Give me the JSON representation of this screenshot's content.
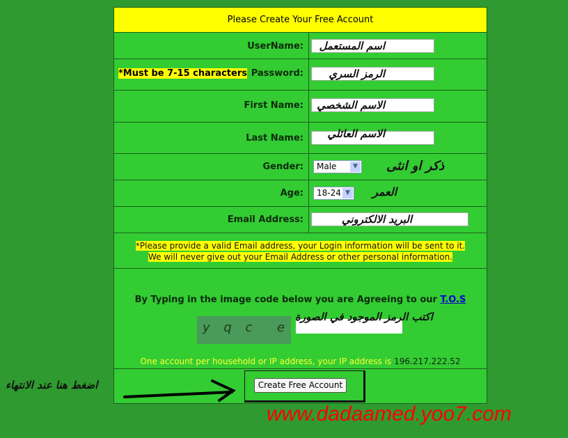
{
  "form": {
    "title": "Please Create Your Free Account",
    "username_label": "UserName:",
    "username_value": "اسم المستعمل",
    "password_hint": "*Must be 7-15 characters",
    "password_label": "Password:",
    "password_value": "الرمز السري",
    "firstname_label": "First Name:",
    "firstname_value": "الاسم الشخصي",
    "lastname_label": "Last Name:",
    "lastname_value": "الاسم العائلي",
    "gender_label": "Gender:",
    "gender_value": "Male",
    "gender_note": "ذكر او انثى",
    "age_label": "Age:",
    "age_value": "18-24",
    "age_note": "العمر",
    "email_label": "Email Address:",
    "email_value": "البريد الالكتروني",
    "email_notice_1": "*Please provide a valid Email address, your Login information will be sent to it.",
    "email_notice_2": "We will never give out your Email Address or other personal information.",
    "tos_text": "By Typing in the image code below you are Agreeing to our",
    "tos_link": "T.O.S",
    "captcha_image_text": "y q c  e n",
    "captcha_note": "اكتب الرمز الموجود في الصورة",
    "ip_notice": "One account per household or IP address, your IP address is",
    "ip_address": "196.217.222.52",
    "submit_label": "Create Free Account",
    "submit_note": "اضغط هنا عند الانتهاء"
  },
  "watermark": "www.dadaamed.yoo7.com",
  "colors": {
    "page_bg": "#2f9a30",
    "form_bg": "#33cc33",
    "header_bg": "#ffff00",
    "watermark": "#ff0000",
    "ip_notice": "#ffff33"
  }
}
